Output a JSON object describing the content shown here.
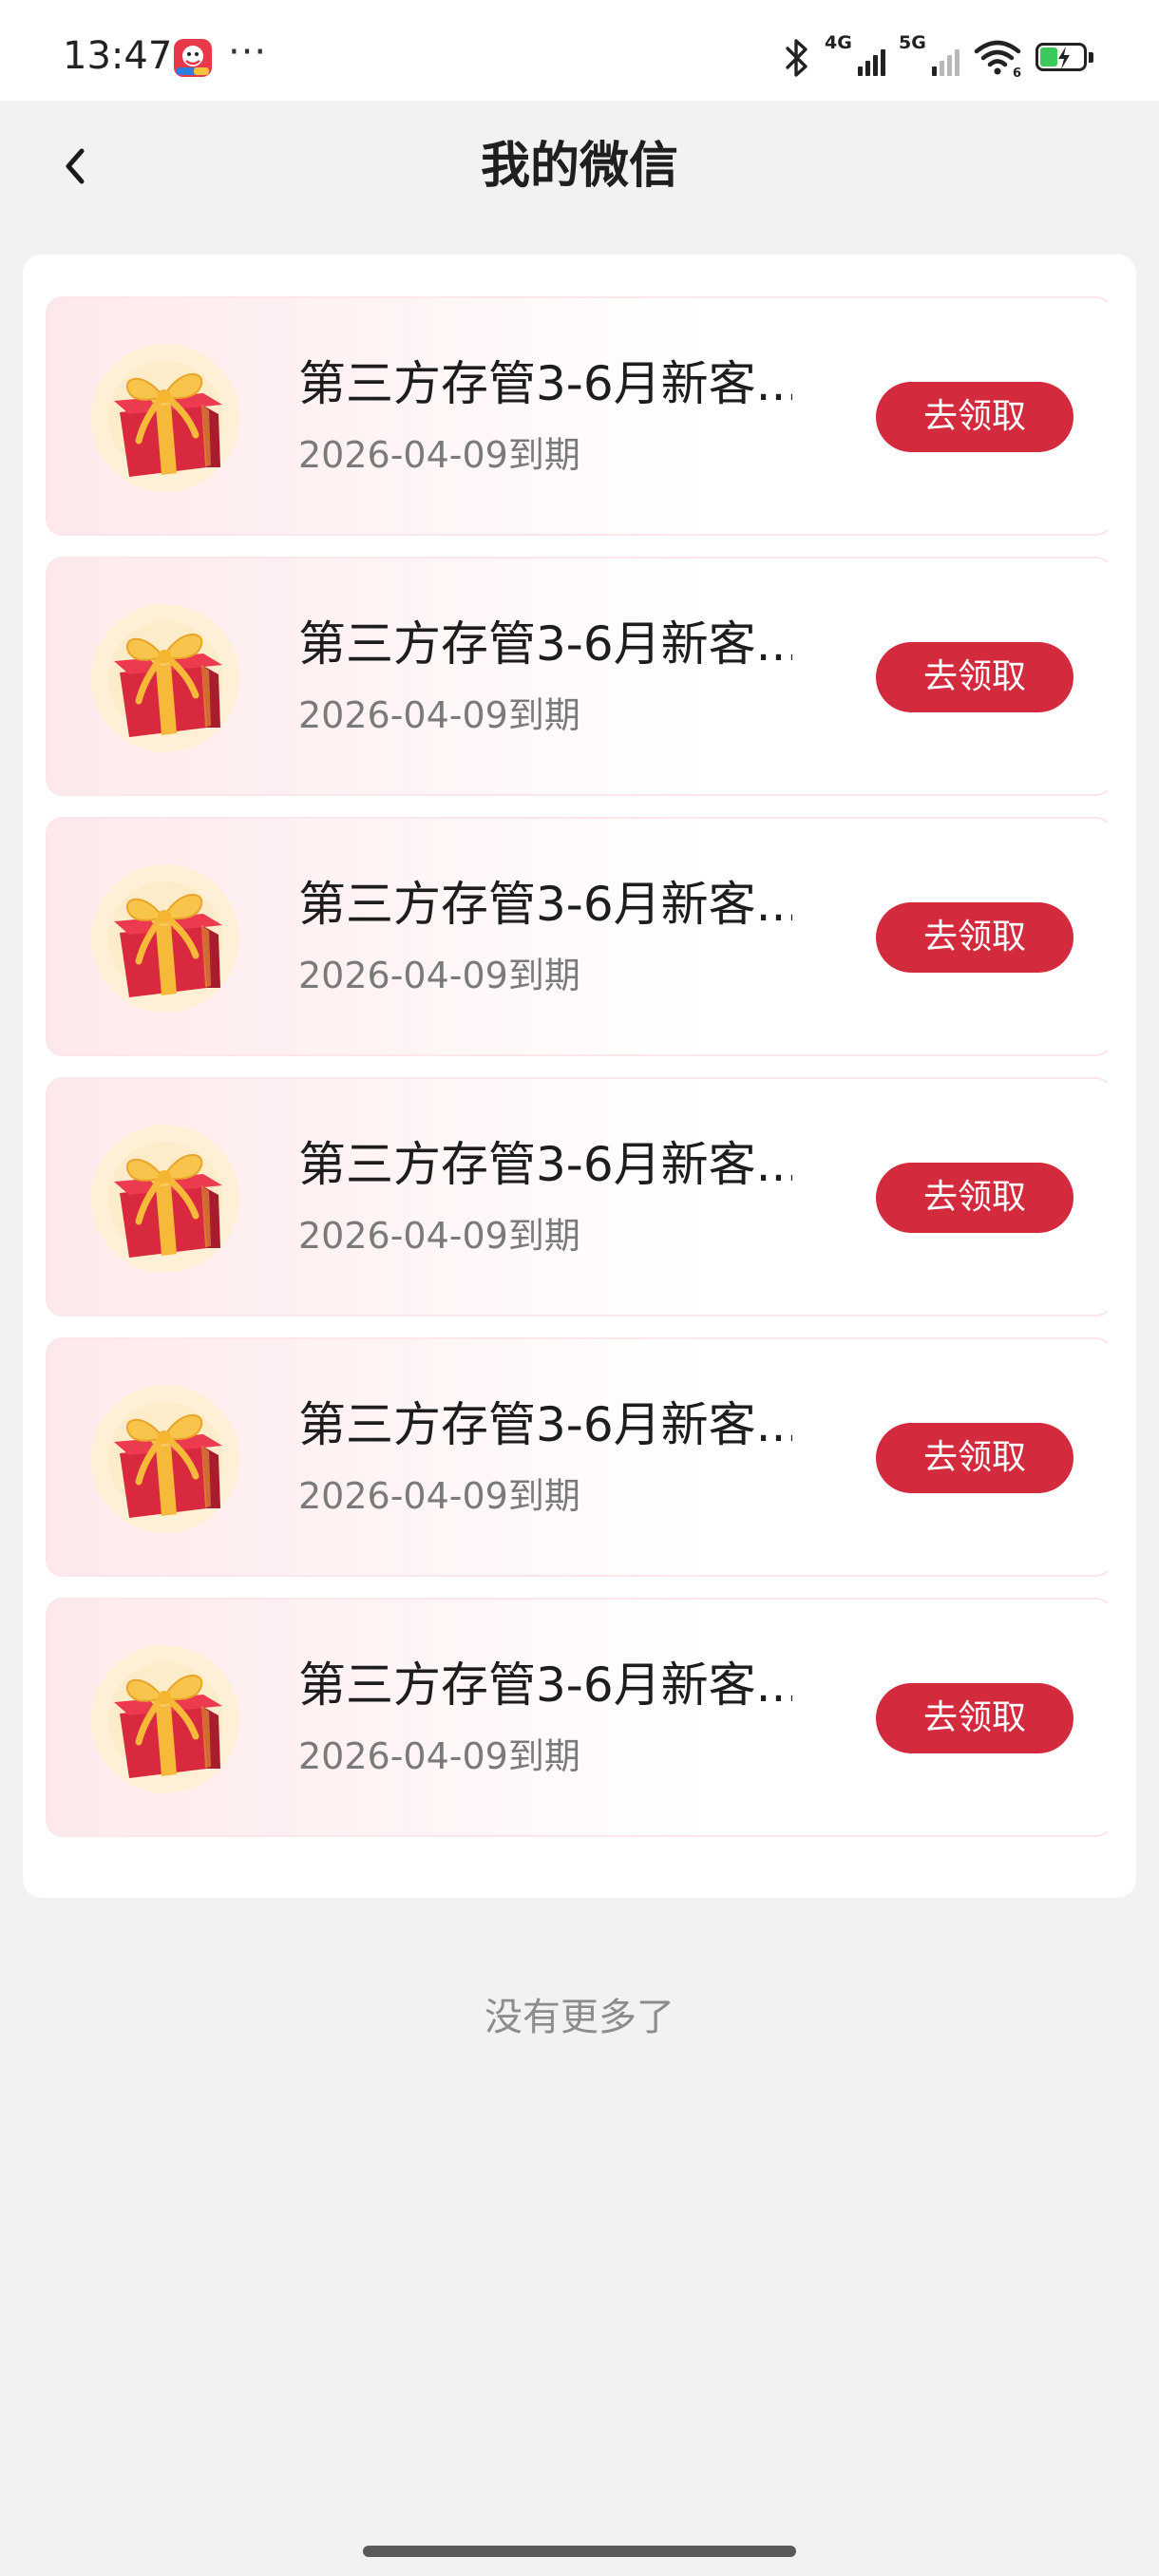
{
  "status_bar": {
    "time": "13:47",
    "dots": "···",
    "network_1": "4G",
    "network_2": "5G",
    "wifi_badge": "6",
    "icons": [
      "app-notification-icon",
      "bluetooth-icon",
      "signal-4g-icon",
      "signal-5g-icon",
      "wifi-icon",
      "battery-charging-icon"
    ],
    "battery_fill_color": "#3cc85a"
  },
  "header": {
    "title": "我的微信",
    "back_icon": "chevron-left-icon"
  },
  "coupons": [
    {
      "title": "第三方存管3-6月新客...",
      "expire": "2026-04-09到期",
      "button": "去领取"
    },
    {
      "title": "第三方存管3-6月新客...",
      "expire": "2026-04-09到期",
      "button": "去领取"
    },
    {
      "title": "第三方存管3-6月新客...",
      "expire": "2026-04-09到期",
      "button": "去领取"
    },
    {
      "title": "第三方存管3-6月新客...",
      "expire": "2026-04-09到期",
      "button": "去领取"
    },
    {
      "title": "第三方存管3-6月新客...",
      "expire": "2026-04-09到期",
      "button": "去领取"
    },
    {
      "title": "第三方存管3-6月新客...",
      "expire": "2026-04-09到期",
      "button": "去领取"
    }
  ],
  "coupon_icon": "gift-box-icon",
  "footer": {
    "no_more": "没有更多了"
  },
  "colors": {
    "accent": "#d42a3d",
    "background": "#f2f2f2",
    "card": "#ffffff"
  }
}
